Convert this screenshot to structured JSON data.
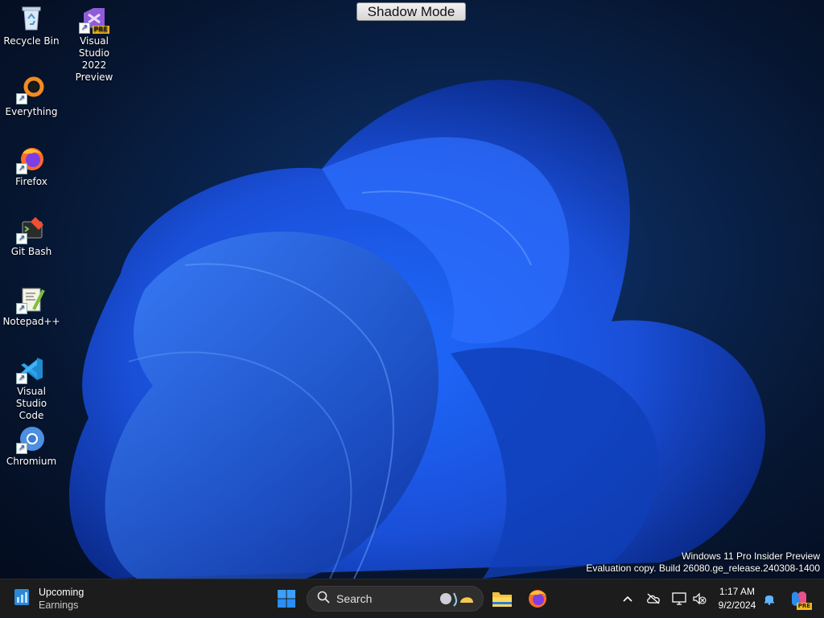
{
  "desktop": {
    "shadow_mode_label": "Shadow Mode",
    "icons": [
      {
        "label_1": "Recycle Bin",
        "label_2": "",
        "icon": "recycle-bin-icon"
      },
      {
        "label_1": "Visual Studio",
        "label_2": "2022 Preview",
        "icon": "visual-studio-icon"
      },
      {
        "label_1": "Everything",
        "label_2": "",
        "icon": "everything-icon"
      },
      {
        "label_1": "Firefox",
        "label_2": "",
        "icon": "firefox-icon"
      },
      {
        "label_1": "Git Bash",
        "label_2": "",
        "icon": "git-bash-icon"
      },
      {
        "label_1": "Notepad++",
        "label_2": "",
        "icon": "notepad-plus-plus-icon"
      },
      {
        "label_1": "Visual Studio",
        "label_2": "Code",
        "icon": "vscode-icon"
      },
      {
        "label_1": "Chromium",
        "label_2": "",
        "icon": "chromium-icon"
      }
    ],
    "watermark": {
      "line1": "Windows 11 Pro Insider Preview",
      "line2": "Evaluation copy. Build 26080.ge_release.240308-1400"
    },
    "vs_badge": "PRE"
  },
  "taskbar": {
    "widget": {
      "title": "Upcoming",
      "subtitle": "Earnings"
    },
    "search_placeholder": "Search",
    "clock": {
      "time": "1:17 AM",
      "date": "9/2/2024"
    },
    "copilot_badge": "PRE"
  },
  "colors": {
    "accent": "#0078d4",
    "taskbar": "#1c1c1c"
  }
}
